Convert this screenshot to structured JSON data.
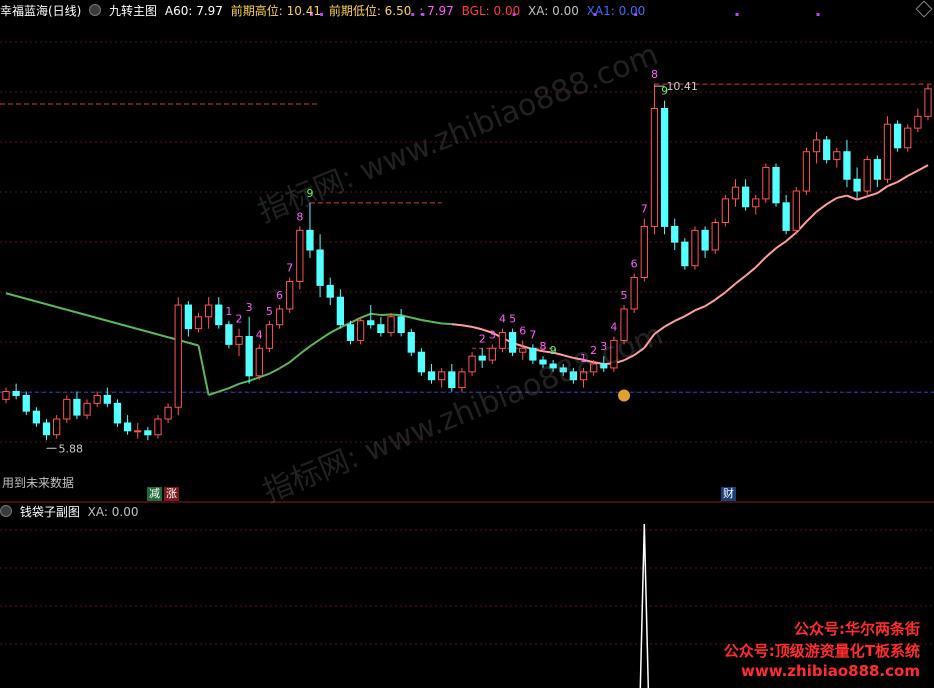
{
  "main_header": {
    "title": "幸福蓝海(日线)",
    "indicator": "九转主图",
    "a60": "A60: 7.97",
    "prev_high": "前期高位: 10.41",
    "prev_low": "前期低位: 6.50",
    "sep_val": ": 7.97",
    "bgl": "BGL: 0.00",
    "xa": "XA: 0.00",
    "xa1": "XA1: 0.00"
  },
  "sub_header": {
    "indicator": "钱袋子副图",
    "xa": "XA: 0.00"
  },
  "future_data_note": "用到未来数据",
  "signals": {
    "jian": "减",
    "zhang": "涨",
    "cai": "财"
  },
  "watermark": "指标网: www.zhibiao888.com",
  "promo": [
    "公众号:华尔两条街",
    "公众号:顶级游资量化T板系统",
    "www.zhibiao888.com"
  ],
  "colors": {
    "up": "#ff5353",
    "down": "#54ffff",
    "ma_low": "#5cb85c",
    "ma_high": "#ffa0a0",
    "count": "#ff5cff",
    "count9": "#5cff5c",
    "promo": "#ff2d2d"
  },
  "chart_data": {
    "type": "candlestick",
    "ylim": [
      5.4,
      11.2
    ],
    "annotations": {
      "low": "5.88",
      "high": "10.41",
      "low_price": 5.88,
      "high_price": 10.41
    },
    "levels": {
      "prev_high": 10.41,
      "a60": 7.97
    },
    "candles": [
      [
        6.4,
        6.55,
        6.35,
        6.5
      ],
      [
        6.5,
        6.6,
        6.4,
        6.45
      ],
      [
        6.45,
        6.5,
        6.2,
        6.25
      ],
      [
        6.25,
        6.3,
        6.05,
        6.1
      ],
      [
        6.1,
        6.15,
        5.88,
        5.95
      ],
      [
        5.95,
        6.2,
        5.9,
        6.15
      ],
      [
        6.15,
        6.45,
        6.1,
        6.4
      ],
      [
        6.4,
        6.5,
        6.15,
        6.2
      ],
      [
        6.2,
        6.4,
        6.15,
        6.35
      ],
      [
        6.35,
        6.5,
        6.3,
        6.45
      ],
      [
        6.45,
        6.55,
        6.3,
        6.35
      ],
      [
        6.35,
        6.4,
        6.05,
        6.1
      ],
      [
        6.1,
        6.2,
        5.95,
        6.0
      ],
      [
        6.0,
        6.1,
        5.9,
        6.0
      ],
      [
        6.0,
        6.05,
        5.88,
        5.95
      ],
      [
        5.95,
        6.2,
        5.9,
        6.15
      ],
      [
        6.15,
        6.35,
        6.1,
        6.3
      ],
      [
        6.3,
        7.7,
        6.2,
        7.6
      ],
      [
        7.6,
        7.65,
        7.2,
        7.3
      ],
      [
        7.3,
        7.5,
        7.25,
        7.45
      ],
      [
        7.45,
        7.7,
        7.3,
        7.6
      ],
      [
        7.6,
        7.7,
        7.3,
        7.35
      ],
      [
        7.35,
        7.4,
        7.05,
        7.1
      ],
      [
        7.1,
        7.3,
        6.95,
        7.2
      ],
      [
        7.2,
        7.45,
        6.6,
        6.7
      ],
      [
        6.7,
        7.1,
        6.65,
        7.05
      ],
      [
        7.05,
        7.4,
        7.0,
        7.35
      ],
      [
        7.35,
        7.6,
        7.3,
        7.55
      ],
      [
        7.55,
        7.95,
        7.5,
        7.9
      ],
      [
        7.9,
        8.6,
        7.8,
        8.55
      ],
      [
        8.55,
        8.9,
        8.2,
        8.3
      ],
      [
        8.3,
        8.5,
        7.7,
        7.85
      ],
      [
        7.85,
        7.95,
        7.6,
        7.7
      ],
      [
        7.7,
        7.8,
        7.3,
        7.35
      ],
      [
        7.35,
        7.4,
        7.1,
        7.15
      ],
      [
        7.15,
        7.45,
        7.1,
        7.4
      ],
      [
        7.4,
        7.6,
        7.3,
        7.35
      ],
      [
        7.35,
        7.45,
        7.2,
        7.25
      ],
      [
        7.25,
        7.5,
        7.2,
        7.45
      ],
      [
        7.45,
        7.55,
        7.2,
        7.25
      ],
      [
        7.25,
        7.3,
        6.95,
        7.0
      ],
      [
        7.0,
        7.05,
        6.7,
        6.75
      ],
      [
        6.75,
        6.85,
        6.6,
        6.65
      ],
      [
        6.65,
        6.8,
        6.55,
        6.75
      ],
      [
        6.75,
        6.85,
        6.5,
        6.55
      ],
      [
        6.55,
        6.8,
        6.5,
        6.75
      ],
      [
        6.75,
        7.0,
        6.7,
        6.95
      ],
      [
        6.95,
        7.05,
        6.8,
        6.9
      ],
      [
        6.9,
        7.1,
        6.85,
        7.05
      ],
      [
        7.05,
        7.3,
        7.0,
        7.25
      ],
      [
        7.25,
        7.3,
        6.95,
        7.0
      ],
      [
        7.0,
        7.15,
        6.9,
        7.05
      ],
      [
        7.05,
        7.1,
        6.85,
        6.9
      ],
      [
        6.9,
        6.95,
        6.8,
        6.85
      ],
      [
        6.85,
        6.9,
        6.75,
        6.8
      ],
      [
        6.8,
        6.85,
        6.7,
        6.75
      ],
      [
        6.75,
        6.8,
        6.6,
        6.65
      ],
      [
        6.65,
        6.8,
        6.55,
        6.75
      ],
      [
        6.75,
        6.9,
        6.7,
        6.85
      ],
      [
        6.85,
        6.95,
        6.75,
        6.8
      ],
      [
        6.8,
        7.2,
        6.75,
        7.15
      ],
      [
        7.15,
        7.6,
        7.1,
        7.55
      ],
      [
        7.55,
        8.0,
        7.5,
        7.95
      ],
      [
        7.95,
        8.7,
        7.9,
        8.6
      ],
      [
        8.6,
        10.41,
        8.5,
        10.1
      ],
      [
        10.1,
        10.2,
        8.5,
        8.6
      ],
      [
        8.6,
        8.7,
        8.3,
        8.4
      ],
      [
        8.4,
        8.45,
        8.05,
        8.1
      ],
      [
        8.1,
        8.6,
        8.05,
        8.55
      ],
      [
        8.55,
        8.6,
        8.2,
        8.3
      ],
      [
        8.3,
        8.7,
        8.25,
        8.65
      ],
      [
        8.65,
        9.0,
        8.6,
        8.95
      ],
      [
        8.95,
        9.2,
        8.85,
        9.1
      ],
      [
        9.1,
        9.2,
        8.8,
        8.85
      ],
      [
        8.85,
        9.0,
        8.75,
        8.95
      ],
      [
        8.95,
        9.4,
        8.9,
        9.35
      ],
      [
        9.35,
        9.4,
        8.85,
        8.9
      ],
      [
        8.9,
        9.0,
        8.5,
        8.55
      ],
      [
        8.55,
        9.1,
        8.5,
        9.05
      ],
      [
        9.05,
        9.6,
        9.0,
        9.55
      ],
      [
        9.55,
        9.8,
        9.4,
        9.7
      ],
      [
        9.7,
        9.75,
        9.4,
        9.45
      ],
      [
        9.45,
        9.6,
        9.35,
        9.55
      ],
      [
        9.55,
        9.7,
        9.1,
        9.2
      ],
      [
        9.2,
        9.35,
        8.95,
        9.05
      ],
      [
        9.05,
        9.5,
        9.0,
        9.45
      ],
      [
        9.45,
        9.5,
        9.1,
        9.2
      ],
      [
        9.2,
        10.0,
        9.15,
        9.9
      ],
      [
        9.9,
        9.95,
        9.55,
        9.6
      ],
      [
        9.6,
        9.9,
        9.55,
        9.85
      ],
      [
        9.85,
        10.1,
        9.8,
        10.0
      ],
      [
        10.0,
        10.4,
        9.95,
        10.35
      ]
    ],
    "counts": [
      {
        "i": 22,
        "n": "1"
      },
      {
        "i": 23,
        "n": "2"
      },
      {
        "i": 24,
        "n": "3"
      },
      {
        "i": 25,
        "n": "4"
      },
      {
        "i": 26,
        "n": "5"
      },
      {
        "i": 27,
        "n": "6"
      },
      {
        "i": 28,
        "n": "7"
      },
      {
        "i": 29,
        "n": "8"
      },
      {
        "i": 30,
        "n": "9"
      },
      {
        "i": 47,
        "n": "2"
      },
      {
        "i": 48,
        "n": "3"
      },
      {
        "i": 49,
        "n": "4"
      },
      {
        "i": 50,
        "n": "5"
      },
      {
        "i": 51,
        "n": "6"
      },
      {
        "i": 52,
        "n": "7"
      },
      {
        "i": 53,
        "n": "8"
      },
      {
        "i": 54,
        "n": "9"
      },
      {
        "i": 57,
        "n": "1"
      },
      {
        "i": 58,
        "n": "2"
      },
      {
        "i": 59,
        "n": "3"
      },
      {
        "i": 60,
        "n": "4"
      },
      {
        "i": 61,
        "n": "5"
      },
      {
        "i": 62,
        "n": "6"
      },
      {
        "i": 63,
        "n": "7"
      },
      {
        "i": 64,
        "n": "8"
      },
      {
        "i": 65,
        "n": "9"
      }
    ],
    "sub_spike": {
      "i": 63,
      "value": 1
    }
  }
}
